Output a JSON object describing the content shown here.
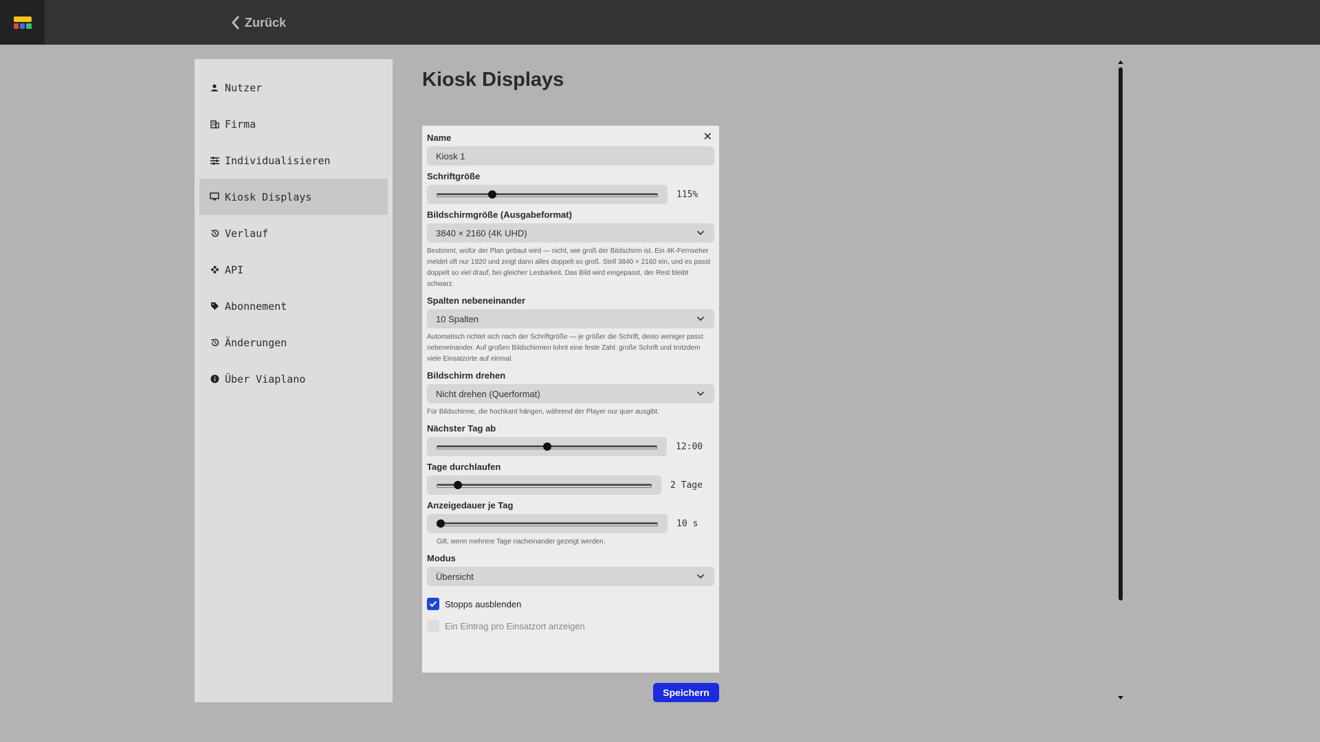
{
  "topbar": {
    "back_label": "Zurück",
    "logo_name": "viaplano-logo"
  },
  "sidebar": {
    "items": [
      {
        "label": "Nutzer",
        "icon": "person-icon"
      },
      {
        "label": "Firma",
        "icon": "building-icon"
      },
      {
        "label": "Individualisieren",
        "icon": "tune-icon"
      },
      {
        "label": "Kiosk Displays",
        "icon": "monitor-icon",
        "active": true
      },
      {
        "label": "Verlauf",
        "icon": "history-icon"
      },
      {
        "label": "API",
        "icon": "api-icon"
      },
      {
        "label": "Abonnement",
        "icon": "tag-icon"
      },
      {
        "label": "Änderungen",
        "icon": "history-icon"
      },
      {
        "label": "Über Viaplano",
        "icon": "info-icon"
      }
    ]
  },
  "page": {
    "title": "Kiosk Displays"
  },
  "form": {
    "name": {
      "label": "Name",
      "value": "Kiosk 1"
    },
    "font_size": {
      "label": "Schriftgröße",
      "value_text": "115%",
      "fraction": 0.25
    },
    "screen_size": {
      "label": "Bildschirmgröße (Ausgabeformat)",
      "value": "3840 × 2160 (4K UHD)",
      "help": "Bestimmt, wofür der Plan gebaut wird — nicht, wie groß der Bildschirm ist. Ein 4K-Fernseher meldet oft nur 1920 und zeigt dann alles doppelt so groß. Stell 3840 × 2160 ein, und es passt doppelt so viel drauf, bei gleicher Lesbarkeit. Das Bild wird eingepasst, der Rest bleibt schwarz."
    },
    "columns": {
      "label": "Spalten nebeneinander",
      "value": "10 Spalten",
      "help": "Automatisch richtet sich nach der Schriftgröße — je größer die Schrift, desto weniger passt nebeneinander. Auf großen Bildschirmen lohnt eine feste Zahl: große Schrift und trotzdem viele Einsatzorte auf einmal."
    },
    "rotate": {
      "label": "Bildschirm drehen",
      "value": "Nicht drehen (Querformat)",
      "help": "Für Bildschirme, die hochkant hängen, während der Player nur quer ausgibt."
    },
    "next_day": {
      "label": "Nächster Tag ab",
      "value_text": "12:00",
      "fraction": 0.5
    },
    "cycle_days": {
      "label": "Tage durchlaufen",
      "value_text": "2 Tage",
      "fraction": 0.1
    },
    "duration": {
      "label": "Anzeigedauer je Tag",
      "value_text": "10 s",
      "fraction": 0.02,
      "help": "Gilt, wenn mehrere Tage nacheinander gezeigt werden."
    },
    "mode": {
      "label": "Modus",
      "value": "Übersicht"
    },
    "hide_stops": {
      "label": "Stopps ausblenden",
      "checked": true
    },
    "cut_checkbox_label": "Ein Eintrag pro Einsatzort anzeigen"
  },
  "actions": {
    "save_label": "Speichern"
  },
  "colors": {
    "accent": "#1a2be0",
    "topbar": "#333333",
    "background": "#b3b3b3"
  }
}
